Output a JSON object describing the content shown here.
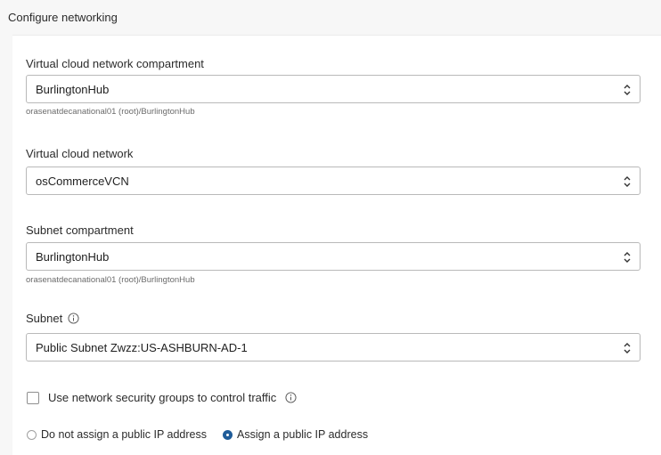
{
  "section": {
    "title": "Configure networking"
  },
  "vcn_compartment": {
    "label": "Virtual cloud network compartment",
    "value": "BurlingtonHub",
    "helper": "orasenatdecanational01 (root)/BurlingtonHub"
  },
  "vcn": {
    "label": "Virtual cloud network",
    "value": "osCommerceVCN"
  },
  "subnet_compartment": {
    "label": "Subnet compartment",
    "value": "BurlingtonHub",
    "helper": "orasenatdecanational01 (root)/BurlingtonHub"
  },
  "subnet": {
    "label": "Subnet",
    "value": "Public Subnet Zwzz:US-ASHBURN-AD-1"
  },
  "nsg": {
    "label": "Use network security groups to control traffic",
    "checked": false
  },
  "public_ip": {
    "options": [
      {
        "label": "Do not assign a public IP address",
        "selected": false
      },
      {
        "label": "Assign a public IP address",
        "selected": true
      }
    ]
  },
  "colors": {
    "accent": "#1f5c99",
    "border": "#b9b9b9",
    "helper_text": "#6b6b6b"
  },
  "icons": {
    "select_chevron": "chevron-up-down-icon",
    "info": "info-icon"
  }
}
